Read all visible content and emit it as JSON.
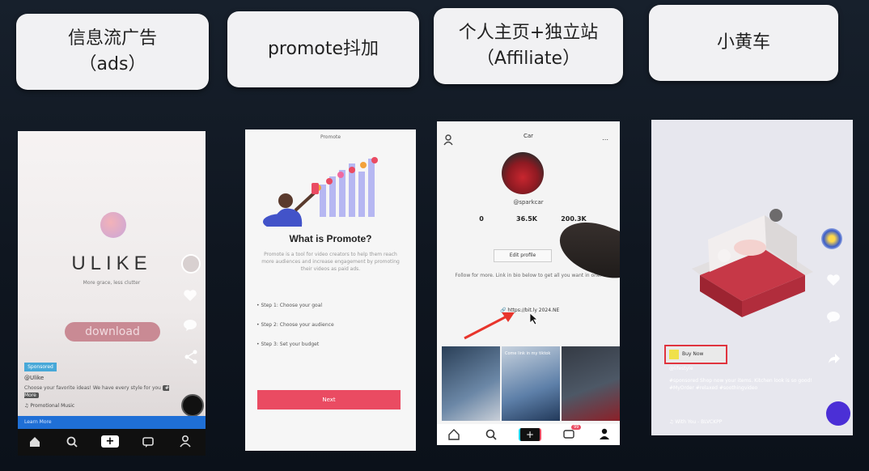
{
  "slide": {
    "headers": [
      {
        "line1": "信息流广告",
        "line2": "（ads）"
      },
      {
        "line1": "promote抖加",
        "line2": ""
      },
      {
        "line1": "个人主页+独立站",
        "line2": "（Affiliate）"
      },
      {
        "line1": "小黄车",
        "line2": ""
      }
    ]
  },
  "phone1": {
    "brand": "ULIKE",
    "tagline": "More grace, less clutter",
    "download_label": "download",
    "sponsored": "Sponsored",
    "handle": "@Ulike",
    "caption": "Choose your favorite ideas! We have every style for you",
    "more": "# More",
    "music": "Promotional Music",
    "learn_more": "Learn More",
    "icons": [
      "home-icon",
      "search-icon",
      "plus-icon",
      "inbox-icon",
      "profile-icon"
    ]
  },
  "phone2": {
    "header": "Promote",
    "title": "What is Promote?",
    "description": "Promote is a tool for video creators to help them reach more audiences and increase engagement by promoting their videos as paid ads.",
    "steps": [
      "Step 1: Choose your goal",
      "Step 2: Choose your audience",
      "Step 3: Set your budget"
    ],
    "button": "Next"
  },
  "phone3": {
    "title": "Car",
    "username": "@sparkcar",
    "stats": [
      "0",
      "36.5K",
      "200.3K"
    ],
    "edit_profile": "Edit profile",
    "bio": "Follow for more. Link in bio below to get all you want in one.",
    "link": "https://bit.ly 2024.NE",
    "promo_label": "Come link in my tiktok",
    "notification_badge": "99"
  },
  "phone4": {
    "buy_label": "Buy Now",
    "account": "@lifestyle",
    "caption": "#sponsored Shop now your items. Kitchen look is so good! #MyOrder #relaxed #soothingvideo",
    "music": "With You - BLVCKPP"
  },
  "colors": {
    "background": "#111923",
    "card": "#f1f1f3",
    "accent_red": "#ea4b62",
    "tiktok_cyan": "#20d5ec",
    "link_blue": "#1f6fd6"
  }
}
